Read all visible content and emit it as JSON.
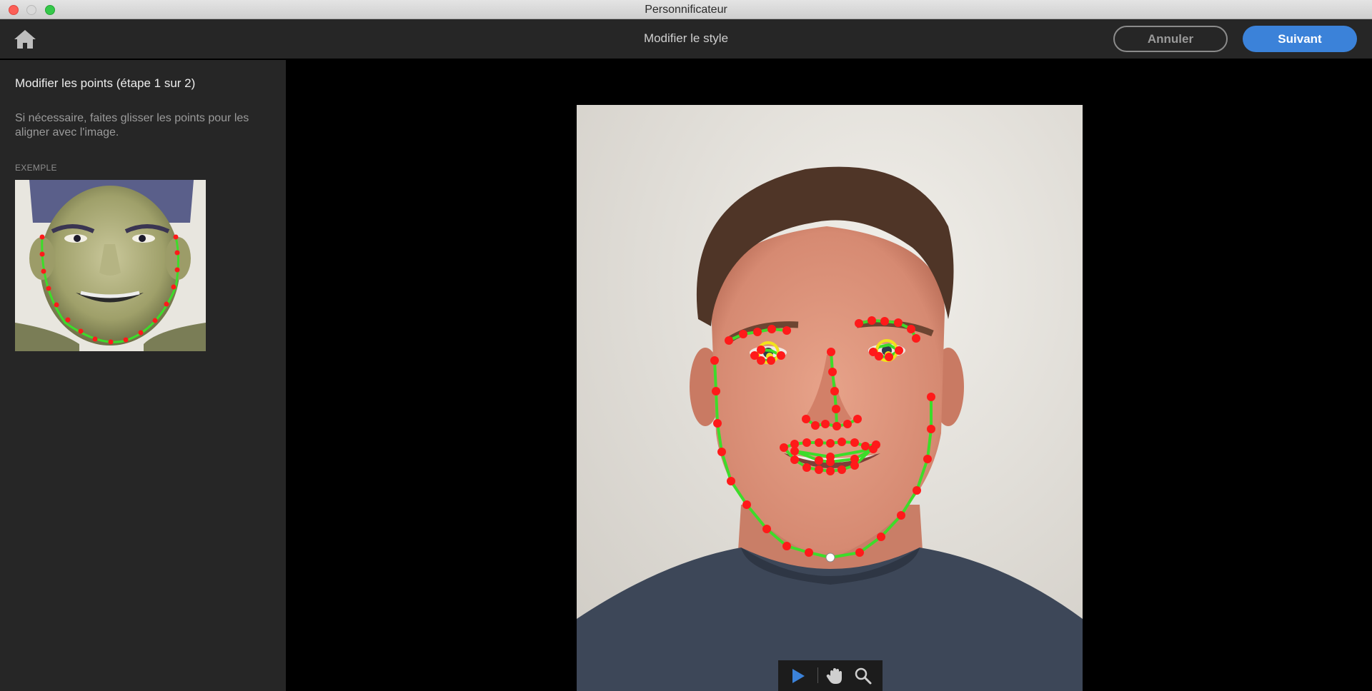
{
  "window": {
    "title": "Personnificateur"
  },
  "header": {
    "page_title": "Modifier le style",
    "cancel_label": "Annuler",
    "next_label": "Suivant"
  },
  "sidebar": {
    "title": "Modifier les points (étape 1 sur 2)",
    "description": "Si nécessaire, faites glisser les points pour les aligner avec l'image.",
    "example_label": "EXEMPLE"
  },
  "tools": [
    "arrow-select-icon",
    "hand-pan-icon",
    "zoom-magnifier-icon"
  ],
  "colors": {
    "accent": "#3b82d9",
    "landmark_point": "#ff1a1a",
    "landmark_line": "#3ddc2a",
    "eye_marker": "#f2e21b"
  }
}
